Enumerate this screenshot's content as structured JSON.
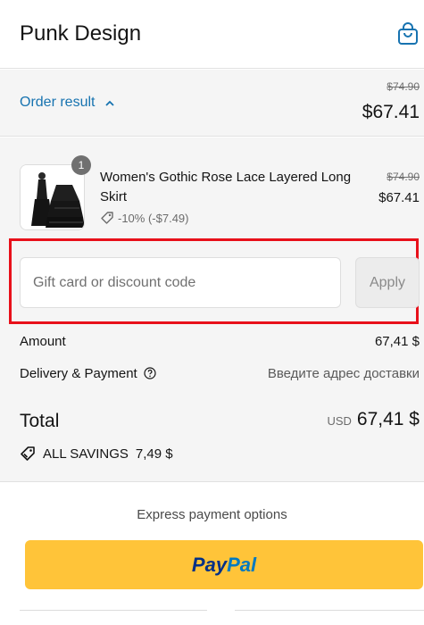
{
  "header": {
    "store_name": "Punk Design",
    "cart_icon": "shopping-bag-icon"
  },
  "order_summary_toggle": {
    "label": "Order result",
    "icon": "chevron-up-icon",
    "original_total": "$74.90",
    "total": "$67.41"
  },
  "line_item": {
    "title": "Women's Gothic Rose Lace Layered Long Skirt",
    "quantity": "1",
    "discount": "-10% (-$7.49)",
    "discount_icon": "tag-icon",
    "original_price": "$74.90",
    "price": "$67.41"
  },
  "discount_code": {
    "placeholder": "Gift card or discount code",
    "value": "",
    "apply_label": "Apply"
  },
  "totals": {
    "amount_label": "Amount",
    "amount_value": "67,41 $",
    "delivery_label": "Delivery & Payment",
    "delivery_value": "Введите адрес доставки",
    "help_icon": "question-circle-icon",
    "total_label": "Total",
    "currency": "USD",
    "total_value": "67,41 $",
    "savings_label": "ALL SAVINGS",
    "savings_value": "7,49 $"
  },
  "express": {
    "title": "Express payment options",
    "paypal_part1": "Pay",
    "paypal_part2": "Pal"
  },
  "colors": {
    "link": "#1773b0",
    "highlight_frame": "#e8101a",
    "paypal_button": "#ffc439",
    "panel_bg": "#f5f5f5"
  }
}
